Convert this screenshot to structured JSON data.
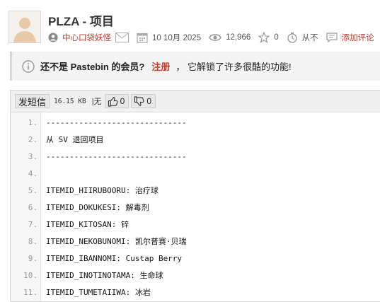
{
  "header": {
    "title": "PLZA - 项目",
    "author": "中心口袋妖怪",
    "date": "10 10月 2025",
    "views": "12,966",
    "likes": "0",
    "expiry": "从不",
    "comment_link": "添加评论"
  },
  "notice": {
    "bold_text": "还不是 Pastebin 的会员?",
    "register_link": "注册",
    "tail_text": "， 它解锁了许多很酷的功能!"
  },
  "toolbar": {
    "send_label": "发短信",
    "size": "16.15 KB",
    "sep": "|无",
    "up_count": "0",
    "down_count": "0"
  },
  "code": {
    "lines": [
      {
        "n": "1.",
        "t": "------------------------------"
      },
      {
        "n": "2.",
        "t": "从 SV 退回项目"
      },
      {
        "n": "3.",
        "t": "------------------------------"
      },
      {
        "n": "4.",
        "t": ""
      },
      {
        "n": "5.",
        "t": "ITEMID_HIIRUBOORU: 治疗球"
      },
      {
        "n": "6.",
        "t": "ITEMID_DOKUKESI: 解毒剂"
      },
      {
        "n": "7.",
        "t": "ITEMID_KITOSAN: 锌"
      },
      {
        "n": "8.",
        "t": "ITEMID_NEKOBUNOMI: 凯尔普赛·贝瑞"
      },
      {
        "n": "9.",
        "t": "ITEMID_IBANNOMI: Custap Berry"
      },
      {
        "n": "10.",
        "t": "ITEMID_INOTINOTAMA: 生命球"
      },
      {
        "n": "11.",
        "t": "ITEMID_TUMETAIIWA: 冰岩"
      }
    ]
  },
  "icons": {
    "avatar": "avatar-icon",
    "user": "user-icon",
    "mail": "mail-icon",
    "calendar": "calendar-icon",
    "eye": "eye-icon",
    "star": "star-icon",
    "timer": "timer-icon",
    "comment": "comment-icon",
    "info": "info-icon",
    "thumbs_up": "thumbs-up-icon",
    "thumbs_down": "thumbs-down-icon"
  },
  "colors": {
    "link": "#c0392b",
    "notice_bg": "#f4f4f4",
    "gutter_bg": "#f6f6f6"
  }
}
